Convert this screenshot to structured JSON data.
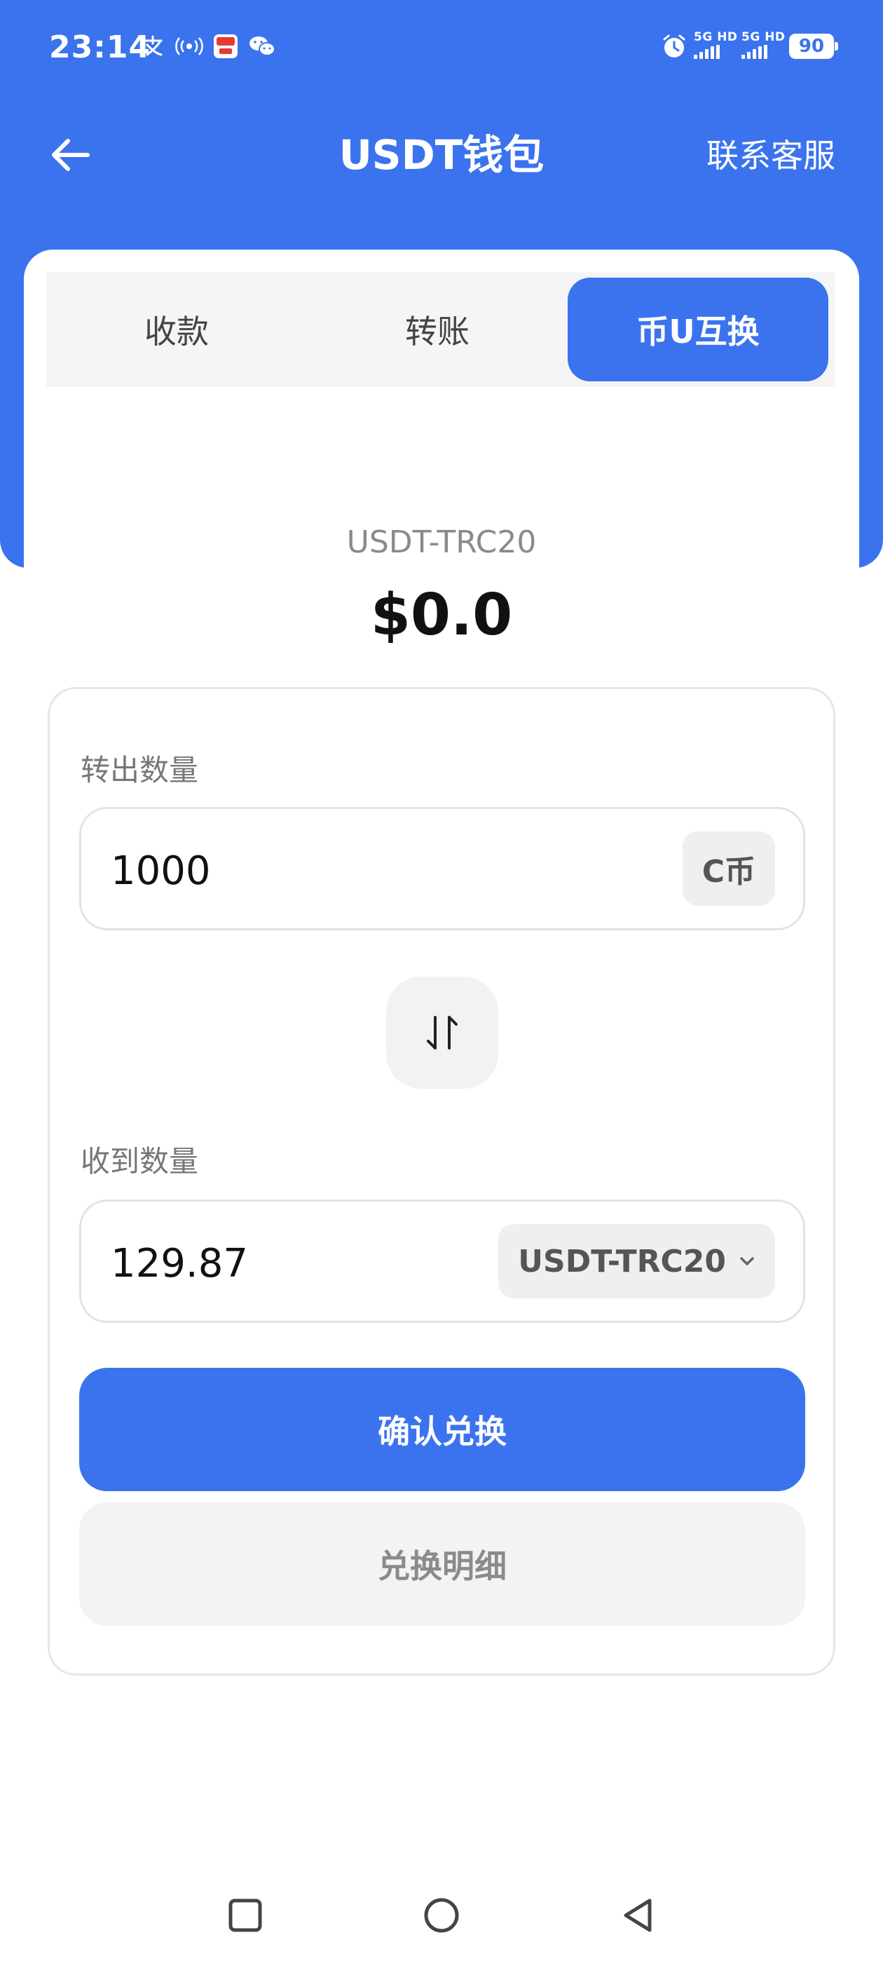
{
  "status_bar": {
    "time": "23:14",
    "notification_icons": [
      "pay-icon",
      "radio-icon",
      "app-icon",
      "wechat-icon"
    ],
    "alarm_icon": "alarm-icon",
    "network_1": "5G HD",
    "network_2": "5G HD",
    "battery": "90"
  },
  "header": {
    "back_icon": "arrow-left-icon",
    "title": "USDT钱包",
    "service": "联系客服"
  },
  "tabs": [
    {
      "label": "收款",
      "active": false
    },
    {
      "label": "转账",
      "active": false
    },
    {
      "label": "币U互换",
      "active": true
    }
  ],
  "wallet": {
    "coin": "USDT-TRC20",
    "balance": "$0.0"
  },
  "exchange": {
    "out_label": "转出数量",
    "out_value": "1000",
    "out_unit": "C币",
    "swap_icon": "swap-arrows-icon",
    "in_label": "收到数量",
    "in_value": "129.87",
    "in_unit": "USDT-TRC20",
    "confirm": "确认兑换",
    "details": "兑换明细"
  },
  "nav": {
    "recent": "square-icon",
    "home": "circle-icon",
    "back": "triangle-back-icon"
  },
  "colors": {
    "primary": "#3b73ee",
    "page": "#ffffff",
    "tab_bg": "#f5f5f5",
    "muted": "#8a8a8a"
  }
}
